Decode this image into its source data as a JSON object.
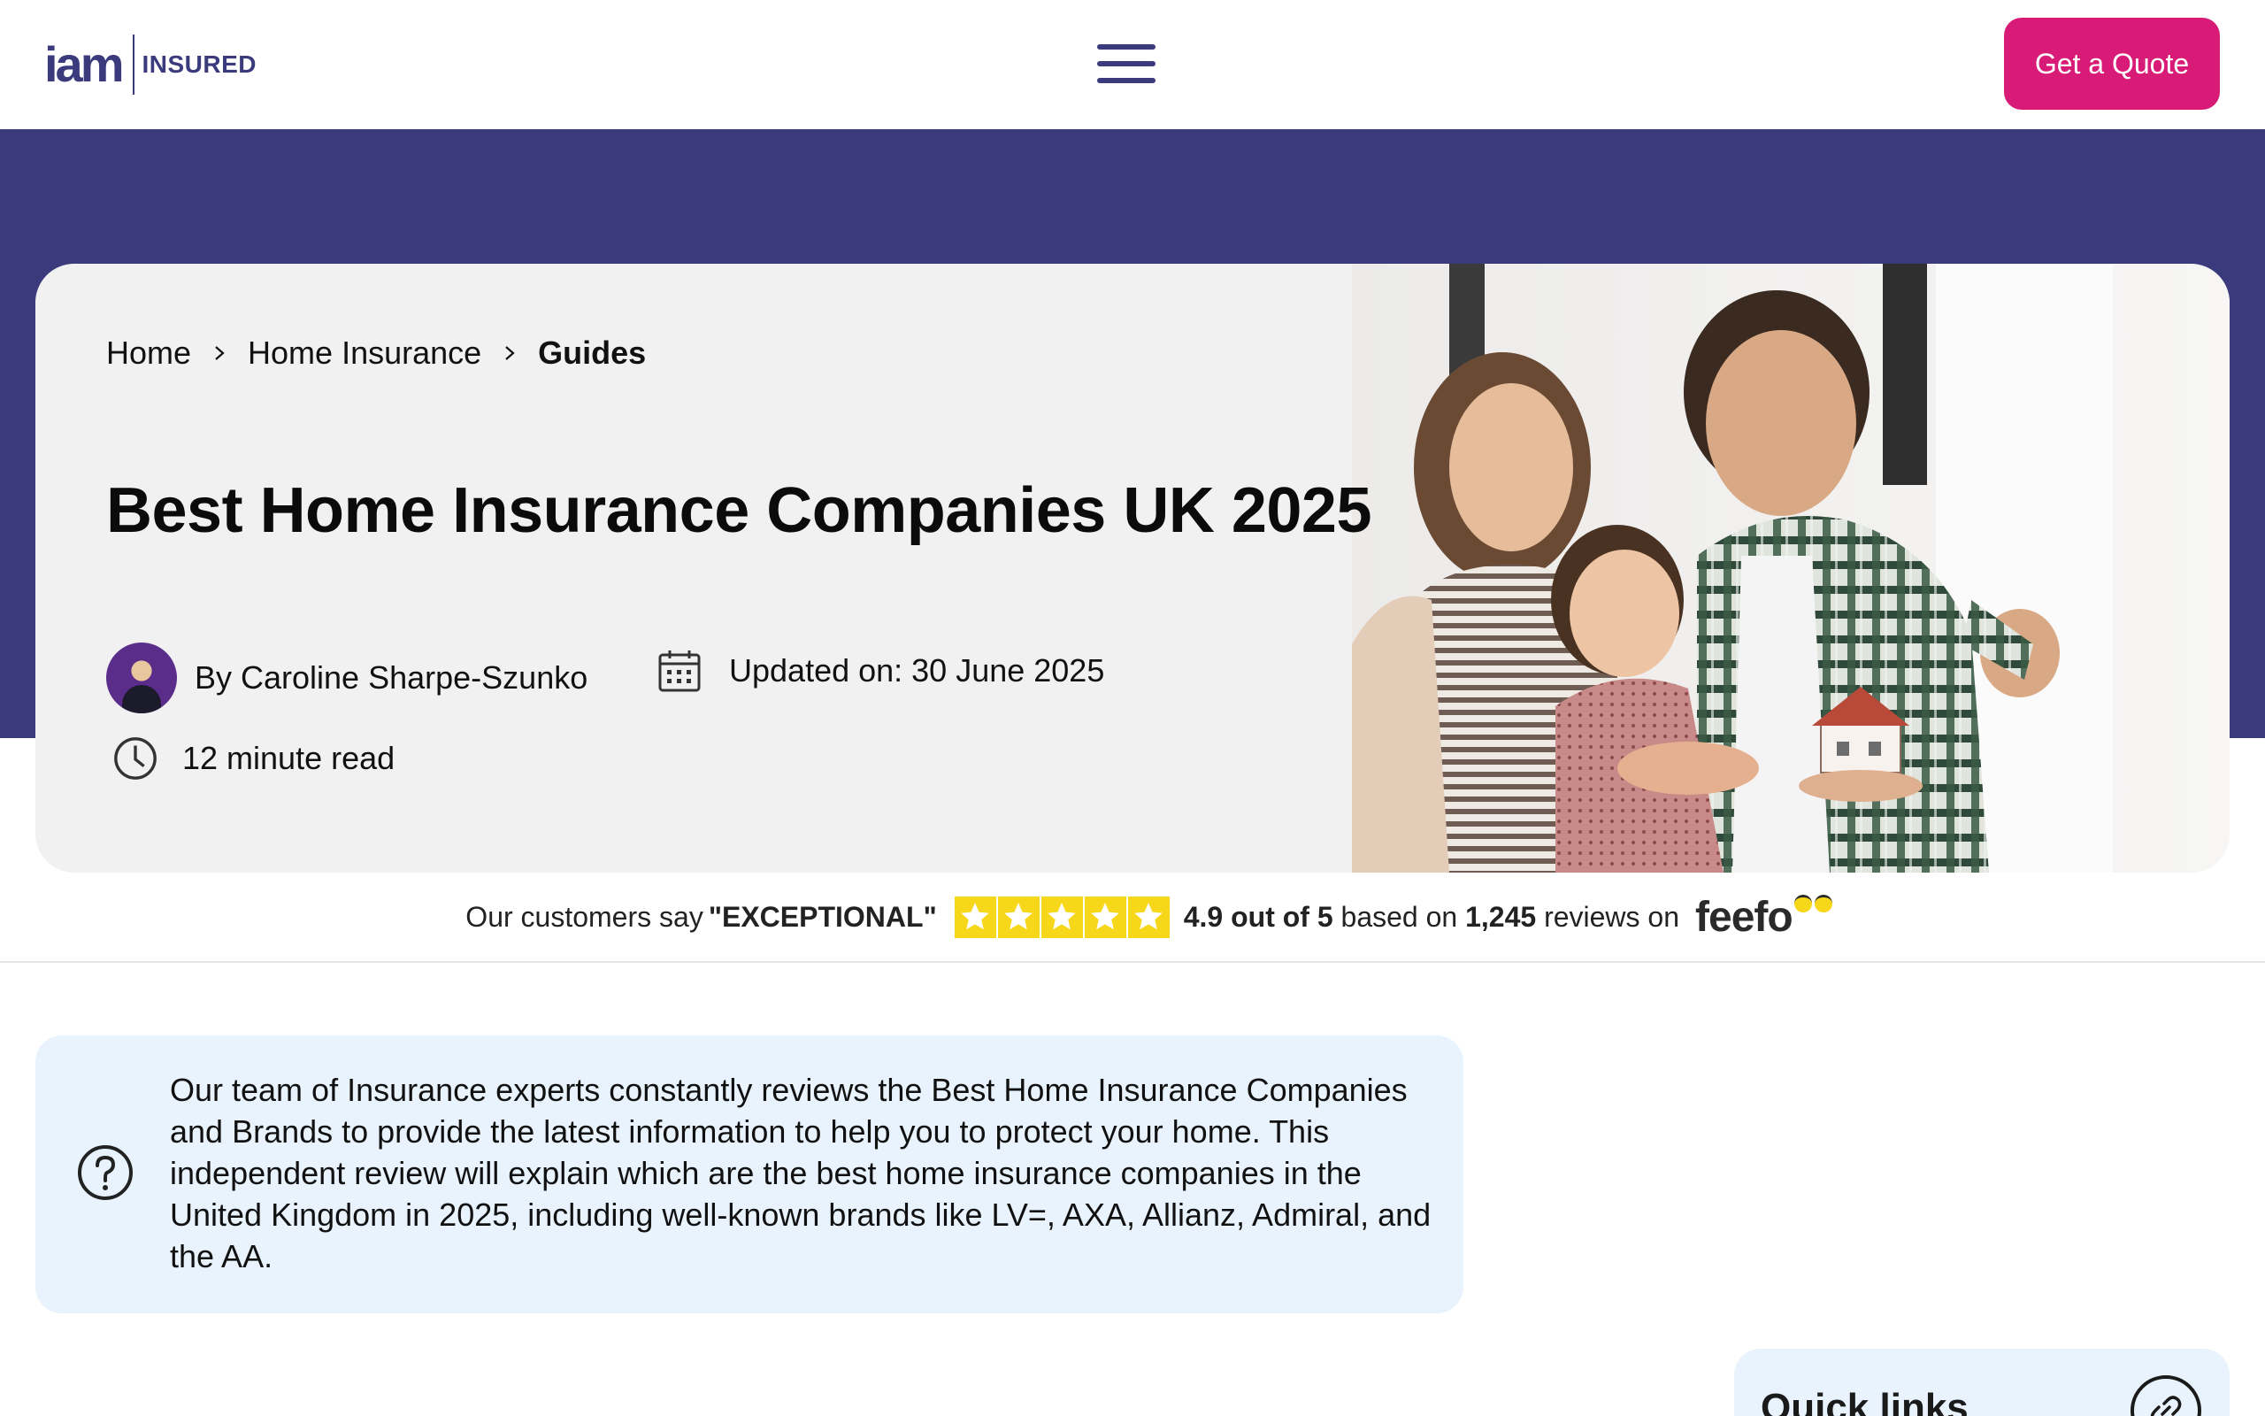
{
  "header": {
    "logo_main": "iam",
    "logo_sub": "INSURED",
    "cta_label": "Get a Quote",
    "menu_icon": "hamburger-menu-icon"
  },
  "breadcrumb": {
    "items": [
      "Home",
      "Home Insurance",
      "Guides"
    ]
  },
  "article": {
    "title": "Best Home Insurance Companies UK 2025",
    "author": "By Caroline Sharpe-Szunko",
    "updated": "Updated on: 30 June 2025",
    "read_time": "12 minute read"
  },
  "feefo": {
    "prefix": "Our customers say ",
    "verdict": "\"EXCEPTIONAL\"",
    "rating": "4.9 out of 5",
    "based_on": " based on ",
    "count": "1,245",
    "reviews_on": " reviews on",
    "brand": "feefo",
    "stars": 5
  },
  "intro": {
    "text": "Our team of Insurance experts constantly reviews the Best Home Insurance Companies and Brands to provide the latest information to help you to protect your home. This independent review will explain which are the best home insurance companies in the United Kingdom in 2025, including well-known brands like LV=, AXA, Allianz, Admiral, and the AA."
  },
  "sidebar": {
    "quick_links_title": "Quick links"
  },
  "colors": {
    "brand_navy": "#3b3a7c",
    "cta_pink": "#d91b78",
    "info_bg": "#e8f3fd",
    "star_yellow": "#f6d71a"
  }
}
